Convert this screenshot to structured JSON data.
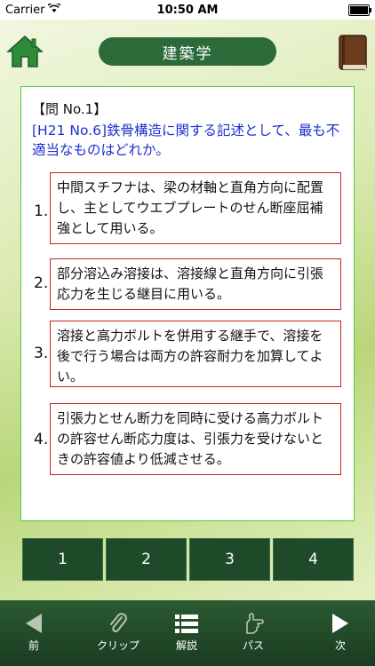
{
  "status": {
    "carrier": "Carrier",
    "time": "10:50 AM"
  },
  "header": {
    "title": "建築学"
  },
  "question": {
    "head": "【問 No.1】",
    "text": "[H21 No.6]鉄骨構造に関する記述として、最も不適当なものはどれか。",
    "options": [
      {
        "num": "1.",
        "text": "中間スチフナは、梁の材軸と直角方向に配置し、主としてウエブプレートのせん断座屈補強として用いる。"
      },
      {
        "num": "2.",
        "text": "部分溶込み溶接は、溶接線と直角方向に引張応力を生じる継目に用いる。"
      },
      {
        "num": "3.",
        "text": "溶接と高力ボルトを併用する継手で、溶接を後で行う場合は両方の許容耐力を加算してよい。"
      },
      {
        "num": "4.",
        "text": "引張力とせん断力を同時に受ける高力ボルトの許容せん断応力度は、引張力を受けないときの許容値より低減させる。"
      }
    ]
  },
  "answers": [
    "1",
    "2",
    "3",
    "4"
  ],
  "toolbar": {
    "prev": "前",
    "clip": "クリップ",
    "explain": "解説",
    "pass": "パス",
    "next": "次"
  },
  "icons": {
    "home": "home-icon",
    "book": "book-icon",
    "prev": "triangle-left-icon",
    "clip": "paperclip-icon",
    "explain": "list-icon",
    "pass": "hand-icon",
    "next": "triangle-right-icon"
  },
  "colors": {
    "accent": "#2d6a3a",
    "option_border": "#c62020",
    "question_text": "#1d2fd0"
  }
}
